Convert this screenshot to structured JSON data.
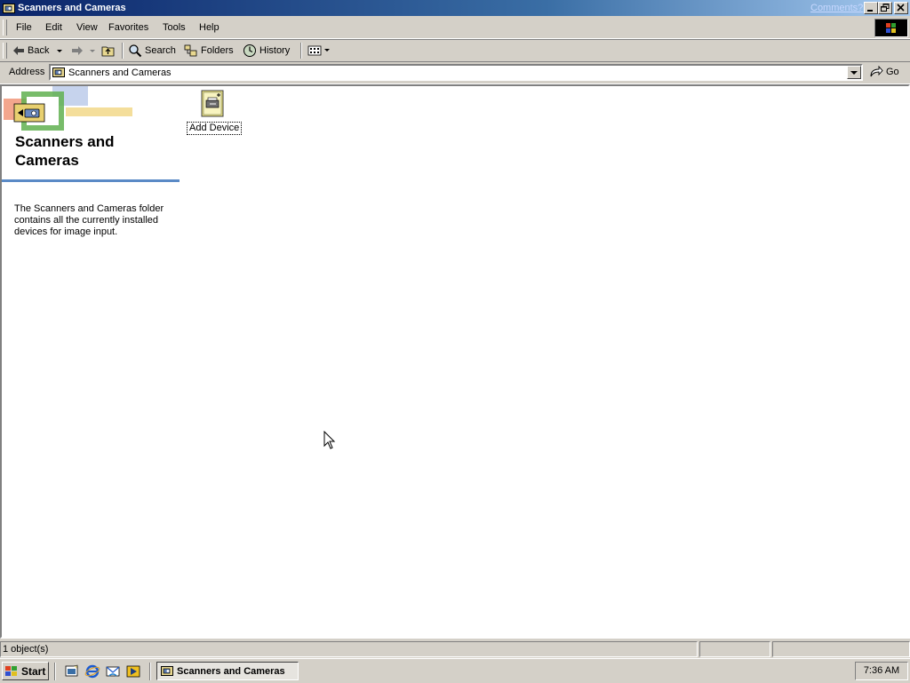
{
  "window": {
    "title": "Scanners and Cameras",
    "comments_link": "Comments?"
  },
  "menu": {
    "items": [
      "File",
      "Edit",
      "View",
      "Favorites",
      "Tools",
      "Help"
    ]
  },
  "toolbar": {
    "back": "Back",
    "search": "Search",
    "folders": "Folders",
    "history": "History"
  },
  "address": {
    "label": "Address",
    "value": "Scanners and Cameras",
    "go": "Go"
  },
  "folder": {
    "title": "Scanners and Cameras",
    "description": "The Scanners and Cameras folder contains all the currently installed devices for image input."
  },
  "items": [
    {
      "label": "Add Device",
      "icon": "add-device-icon"
    }
  ],
  "status": {
    "objects": "1 object(s)"
  },
  "taskbar": {
    "start": "Start",
    "task": "Scanners and Cameras",
    "clock": "7:36 AM"
  }
}
